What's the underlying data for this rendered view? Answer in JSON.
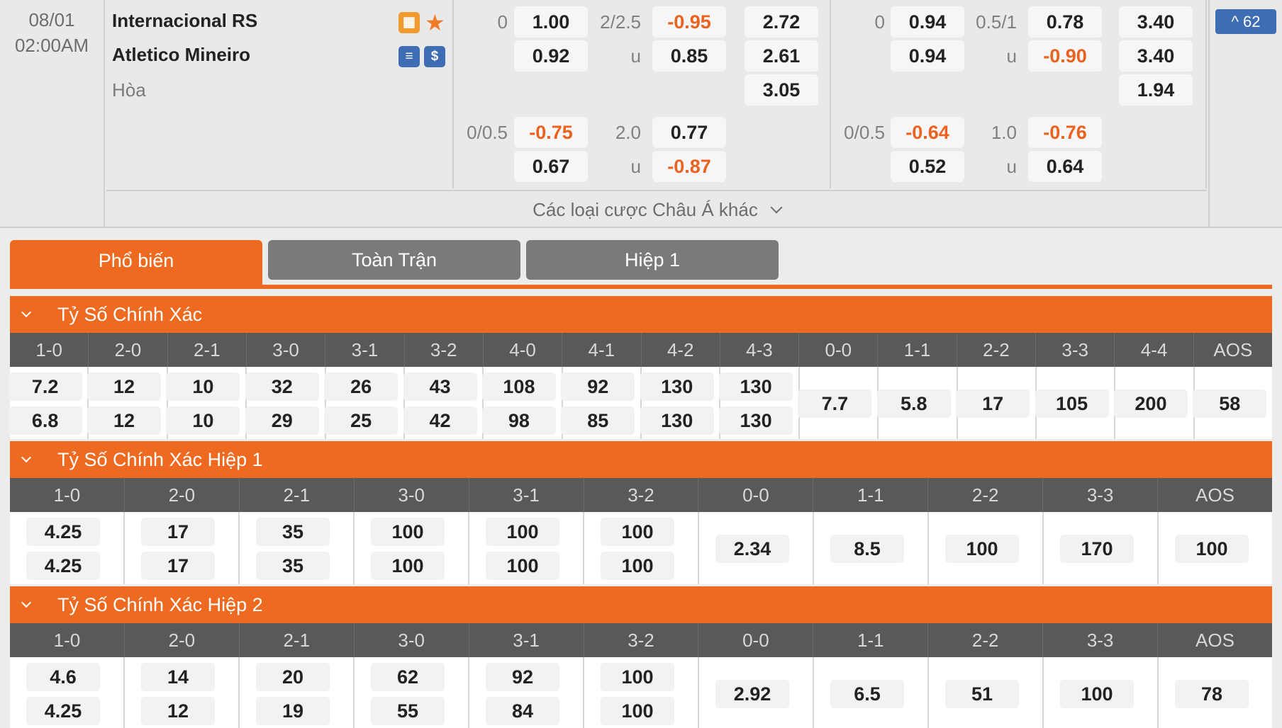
{
  "match": {
    "date": "08/01",
    "time": "02:00AM",
    "home_team": "Internacional RS",
    "away_team": "Atletico Mineiro",
    "draw_label": "Hòa",
    "badge_count": "^ 62",
    "more_bets_label": "Các loại cược Châu Á khác"
  },
  "full_time": {
    "hdp_line1": "0",
    "hdp_home1": "1.00",
    "hdp_away1": "0.92",
    "ou_line1": "2/2.5",
    "ou_over1": "-0.95",
    "ou_under_label1": "u",
    "ou_under1": "0.85",
    "x12_home": "2.72",
    "x12_away": "2.61",
    "x12_draw": "3.05",
    "hdp_line2": "0/0.5",
    "hdp_home2": "-0.75",
    "hdp_away2": "0.67",
    "ou_line2": "2.0",
    "ou_over2": "0.77",
    "ou_under_label2": "u",
    "ou_under2": "-0.87"
  },
  "first_half": {
    "hdp_line1": "0",
    "hdp_home1": "0.94",
    "hdp_away1": "0.94",
    "ou_line1": "0.5/1",
    "ou_over1": "0.78",
    "ou_under_label1": "u",
    "ou_under1": "-0.90",
    "x12_home": "3.40",
    "x12_away": "3.40",
    "x12_draw": "1.94",
    "hdp_line2": "0/0.5",
    "hdp_home2": "-0.64",
    "hdp_away2": "0.52",
    "ou_line2": "1.0",
    "ou_over2": "-0.76",
    "ou_under_label2": "u",
    "ou_under2": "0.64"
  },
  "tabs": [
    {
      "label": "Phổ biến",
      "active": true
    },
    {
      "label": "Toàn Trận",
      "active": false
    },
    {
      "label": "Hiệp 1",
      "active": false
    }
  ],
  "sections": [
    {
      "title": "Tỷ Số Chính Xác",
      "columns": [
        "1-0",
        "2-0",
        "2-1",
        "3-0",
        "3-1",
        "3-2",
        "4-0",
        "4-1",
        "4-2",
        "4-3",
        "0-0",
        "1-1",
        "2-2",
        "3-3",
        "4-4",
        "AOS"
      ],
      "home": [
        "7.2",
        "12",
        "10",
        "32",
        "26",
        "43",
        "108",
        "92",
        "130",
        "130"
      ],
      "away": [
        "6.8",
        "12",
        "10",
        "29",
        "25",
        "42",
        "98",
        "85",
        "130",
        "130"
      ],
      "single": [
        "7.7",
        "5.8",
        "17",
        "105",
        "200",
        "58"
      ]
    },
    {
      "title": "Tỷ Số Chính Xác Hiệp 1",
      "columns": [
        "1-0",
        "2-0",
        "2-1",
        "3-0",
        "3-1",
        "3-2",
        "0-0",
        "1-1",
        "2-2",
        "3-3",
        "AOS"
      ],
      "home": [
        "4.25",
        "17",
        "35",
        "100",
        "100",
        "100"
      ],
      "away": [
        "4.25",
        "17",
        "35",
        "100",
        "100",
        "100"
      ],
      "single": [
        "2.34",
        "8.5",
        "100",
        "170",
        "100"
      ]
    },
    {
      "title": "Tỷ Số Chính Xác Hiệp 2",
      "columns": [
        "1-0",
        "2-0",
        "2-1",
        "3-0",
        "3-1",
        "3-2",
        "0-0",
        "1-1",
        "2-2",
        "3-3",
        "AOS"
      ],
      "home": [
        "4.6",
        "14",
        "20",
        "62",
        "92",
        "100"
      ],
      "away": [
        "4.25",
        "12",
        "19",
        "55",
        "84",
        "100"
      ],
      "single": [
        "2.92",
        "6.5",
        "51",
        "100",
        "78"
      ]
    }
  ],
  "colors": {
    "accent": "#ed6a20",
    "negative_odds": "#ea6120",
    "badge_blue": "#3f6db3",
    "header_gray": "#595959"
  },
  "icons": [
    "lineup-icon",
    "favorite-star-icon",
    "stats-icon",
    "money-icon",
    "chevron-down-icon",
    "chevron-up-icon"
  ]
}
